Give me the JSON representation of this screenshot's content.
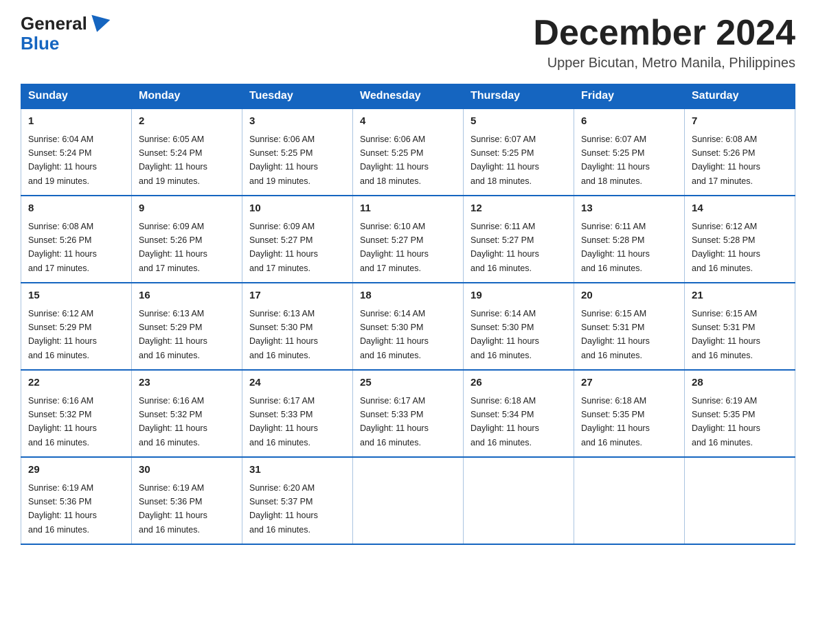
{
  "header": {
    "logo_general": "General",
    "logo_blue": "Blue",
    "month_title": "December 2024",
    "location": "Upper Bicutan, Metro Manila, Philippines"
  },
  "days_of_week": [
    "Sunday",
    "Monday",
    "Tuesday",
    "Wednesday",
    "Thursday",
    "Friday",
    "Saturday"
  ],
  "weeks": [
    [
      {
        "day": "1",
        "sunrise": "6:04 AM",
        "sunset": "5:24 PM",
        "daylight": "11 hours and 19 minutes."
      },
      {
        "day": "2",
        "sunrise": "6:05 AM",
        "sunset": "5:24 PM",
        "daylight": "11 hours and 19 minutes."
      },
      {
        "day": "3",
        "sunrise": "6:06 AM",
        "sunset": "5:25 PM",
        "daylight": "11 hours and 19 minutes."
      },
      {
        "day": "4",
        "sunrise": "6:06 AM",
        "sunset": "5:25 PM",
        "daylight": "11 hours and 18 minutes."
      },
      {
        "day": "5",
        "sunrise": "6:07 AM",
        "sunset": "5:25 PM",
        "daylight": "11 hours and 18 minutes."
      },
      {
        "day": "6",
        "sunrise": "6:07 AM",
        "sunset": "5:25 PM",
        "daylight": "11 hours and 18 minutes."
      },
      {
        "day": "7",
        "sunrise": "6:08 AM",
        "sunset": "5:26 PM",
        "daylight": "11 hours and 17 minutes."
      }
    ],
    [
      {
        "day": "8",
        "sunrise": "6:08 AM",
        "sunset": "5:26 PM",
        "daylight": "11 hours and 17 minutes."
      },
      {
        "day": "9",
        "sunrise": "6:09 AM",
        "sunset": "5:26 PM",
        "daylight": "11 hours and 17 minutes."
      },
      {
        "day": "10",
        "sunrise": "6:09 AM",
        "sunset": "5:27 PM",
        "daylight": "11 hours and 17 minutes."
      },
      {
        "day": "11",
        "sunrise": "6:10 AM",
        "sunset": "5:27 PM",
        "daylight": "11 hours and 17 minutes."
      },
      {
        "day": "12",
        "sunrise": "6:11 AM",
        "sunset": "5:27 PM",
        "daylight": "11 hours and 16 minutes."
      },
      {
        "day": "13",
        "sunrise": "6:11 AM",
        "sunset": "5:28 PM",
        "daylight": "11 hours and 16 minutes."
      },
      {
        "day": "14",
        "sunrise": "6:12 AM",
        "sunset": "5:28 PM",
        "daylight": "11 hours and 16 minutes."
      }
    ],
    [
      {
        "day": "15",
        "sunrise": "6:12 AM",
        "sunset": "5:29 PM",
        "daylight": "11 hours and 16 minutes."
      },
      {
        "day": "16",
        "sunrise": "6:13 AM",
        "sunset": "5:29 PM",
        "daylight": "11 hours and 16 minutes."
      },
      {
        "day": "17",
        "sunrise": "6:13 AM",
        "sunset": "5:30 PM",
        "daylight": "11 hours and 16 minutes."
      },
      {
        "day": "18",
        "sunrise": "6:14 AM",
        "sunset": "5:30 PM",
        "daylight": "11 hours and 16 minutes."
      },
      {
        "day": "19",
        "sunrise": "6:14 AM",
        "sunset": "5:30 PM",
        "daylight": "11 hours and 16 minutes."
      },
      {
        "day": "20",
        "sunrise": "6:15 AM",
        "sunset": "5:31 PM",
        "daylight": "11 hours and 16 minutes."
      },
      {
        "day": "21",
        "sunrise": "6:15 AM",
        "sunset": "5:31 PM",
        "daylight": "11 hours and 16 minutes."
      }
    ],
    [
      {
        "day": "22",
        "sunrise": "6:16 AM",
        "sunset": "5:32 PM",
        "daylight": "11 hours and 16 minutes."
      },
      {
        "day": "23",
        "sunrise": "6:16 AM",
        "sunset": "5:32 PM",
        "daylight": "11 hours and 16 minutes."
      },
      {
        "day": "24",
        "sunrise": "6:17 AM",
        "sunset": "5:33 PM",
        "daylight": "11 hours and 16 minutes."
      },
      {
        "day": "25",
        "sunrise": "6:17 AM",
        "sunset": "5:33 PM",
        "daylight": "11 hours and 16 minutes."
      },
      {
        "day": "26",
        "sunrise": "6:18 AM",
        "sunset": "5:34 PM",
        "daylight": "11 hours and 16 minutes."
      },
      {
        "day": "27",
        "sunrise": "6:18 AM",
        "sunset": "5:35 PM",
        "daylight": "11 hours and 16 minutes."
      },
      {
        "day": "28",
        "sunrise": "6:19 AM",
        "sunset": "5:35 PM",
        "daylight": "11 hours and 16 minutes."
      }
    ],
    [
      {
        "day": "29",
        "sunrise": "6:19 AM",
        "sunset": "5:36 PM",
        "daylight": "11 hours and 16 minutes."
      },
      {
        "day": "30",
        "sunrise": "6:19 AM",
        "sunset": "5:36 PM",
        "daylight": "11 hours and 16 minutes."
      },
      {
        "day": "31",
        "sunrise": "6:20 AM",
        "sunset": "5:37 PM",
        "daylight": "11 hours and 16 minutes."
      },
      null,
      null,
      null,
      null
    ]
  ],
  "labels": {
    "sunrise": "Sunrise:",
    "sunset": "Sunset:",
    "daylight": "Daylight:"
  }
}
